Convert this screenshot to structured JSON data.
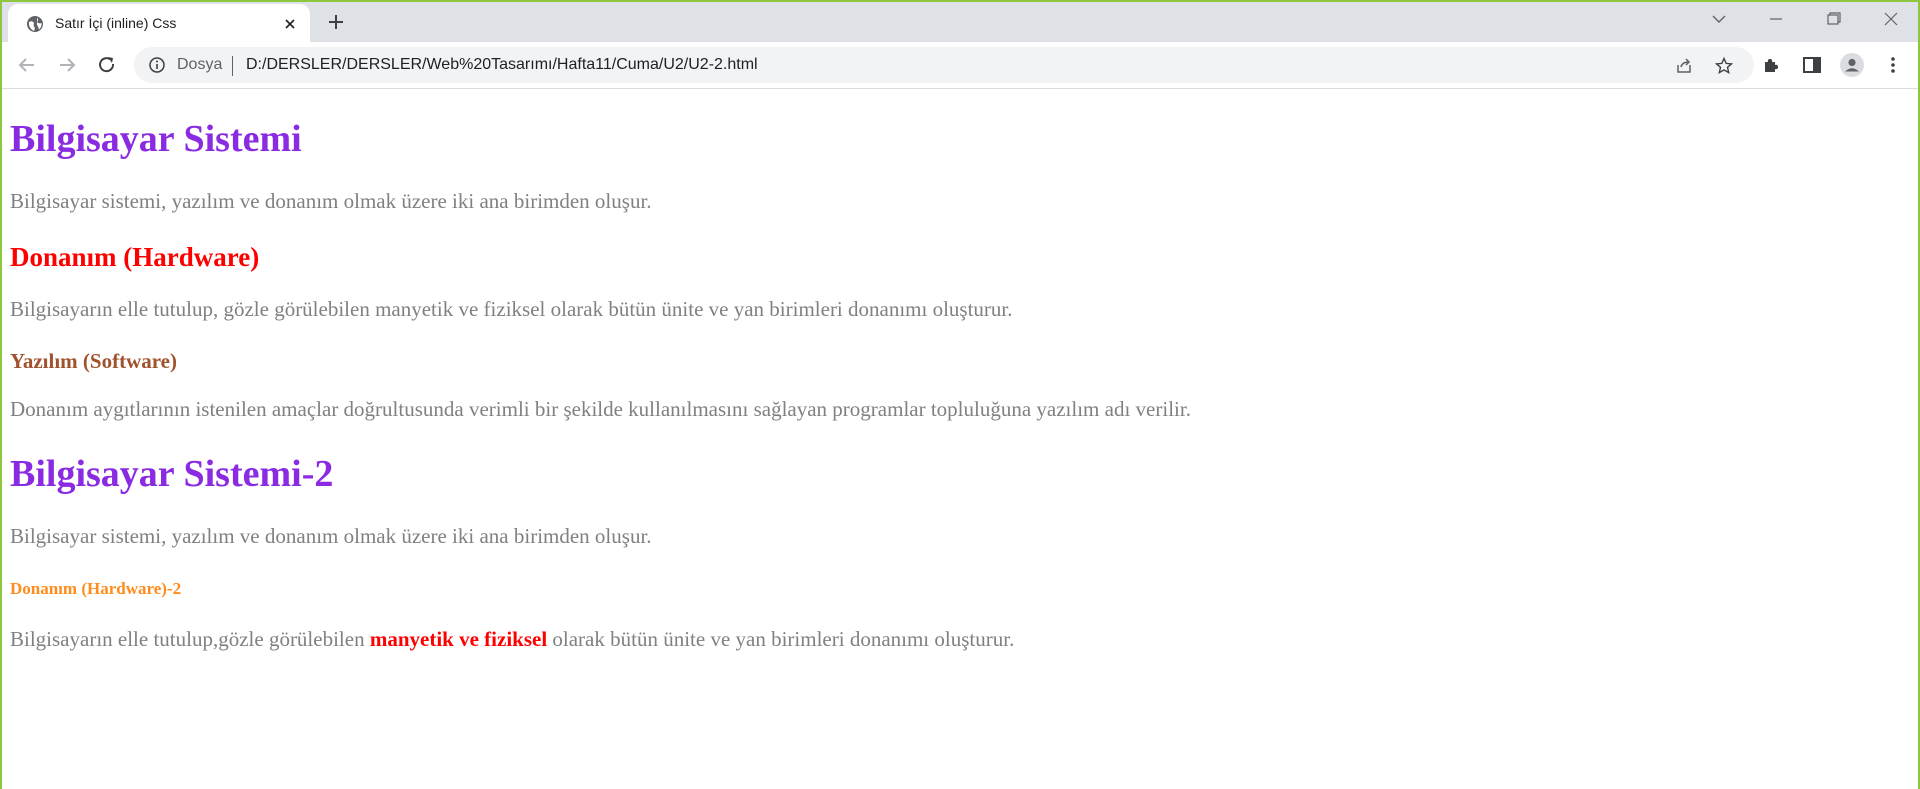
{
  "browser": {
    "tab_title": "Satır İçi (inline) Css",
    "omnibox_chip": "Dosya",
    "url": "D:/DERSLER/DERSLER/Web%20Tasarımı/Hafta11/Cuma/U2/U2-2.html"
  },
  "page": {
    "heading1": "Bilgisayar Sistemi",
    "para1": "Bilgisayar sistemi, yazılım ve donanım olmak üzere iki ana birimden oluşur.",
    "heading2": "Donanım (Hardware)",
    "para2": "Bilgisayarın elle tutulup, gözle görülebilen manyetik ve fiziksel olarak bütün ünite ve yan birimleri donanımı oluşturur.",
    "heading3": "Yazılım (Software)",
    "para3": "Donanım aygıtlarının istenilen amaçlar doğrultusunda verimli bir şekilde kullanılmasını sağlayan programlar topluluğuna yazılım adı verilir.",
    "heading4": "Bilgisayar Sistemi-2",
    "para4": "Bilgisayar sistemi, yazılım ve donanım olmak üzere iki ana birimden oluşur.",
    "heading5": "Donanım (Hardware)-2",
    "para5_before": "Bilgisayarın elle tutulup,gözle görülebilen ",
    "para5_highlight": "manyetik ve fiziksel",
    "para5_after": " olarak bütün ünite ve yan birimleri donanımı oluşturur."
  },
  "colors": {
    "frame": "#8dc63f",
    "h1": "#8a2be2",
    "h2": "#ff0000",
    "h3": "#a0522d",
    "h5": "#ff8c1a",
    "paragraph": "#808080"
  }
}
